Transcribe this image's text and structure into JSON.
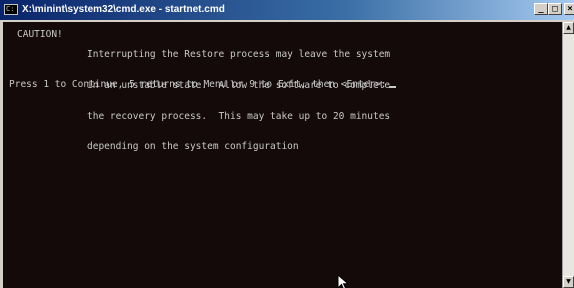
{
  "window": {
    "title": "X:\\minint\\system32\\cmd.exe - startnet.cmd",
    "icon": "cmd-icon",
    "controls": {
      "minimize": "_",
      "maximize": "□",
      "close": "×"
    }
  },
  "console": {
    "caution_label": "CAUTION!",
    "caution_lines": [
      "Interrupting the Restore process may leave the system",
      "in an unstable state.  Allow the software to complete",
      "the recovery process.  This may take up to 20 minutes",
      "depending on the system configuration"
    ],
    "prompt": "Press 1 to Continue, 5 returns to Menu or 9 to Exit, then <Enter>:"
  },
  "colors": {
    "console_background": "#140a0a",
    "console_text": "#c8c8c8",
    "titlebar_start": "#0a246a",
    "titlebar_end": "#a6caf0"
  }
}
